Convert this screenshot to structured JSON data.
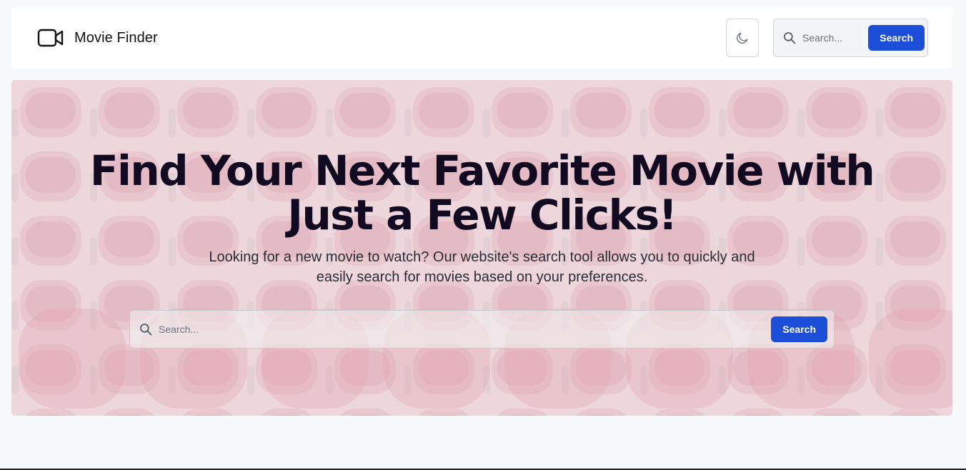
{
  "navbar": {
    "brand_title": "Movie Finder",
    "brand_icon": "video-camera-icon",
    "theme_toggle_icon": "moon-icon",
    "search": {
      "placeholder": "Search...",
      "button_label": "Search"
    }
  },
  "hero": {
    "title": "Find Your Next Favorite Movie with Just a Few Clicks!",
    "subtitle": "Looking for a new movie to watch? Our website's search tool allows you to quickly and easily search for movies based on your preferences.",
    "search": {
      "placeholder": "Search...",
      "button_label": "Search"
    },
    "background_image": "red-cinema-seats"
  },
  "colors": {
    "accent": "#1d4ed8",
    "title": "#120a20",
    "hero_tint": "#eedfe3",
    "page_bg": "#f8f9fb"
  }
}
